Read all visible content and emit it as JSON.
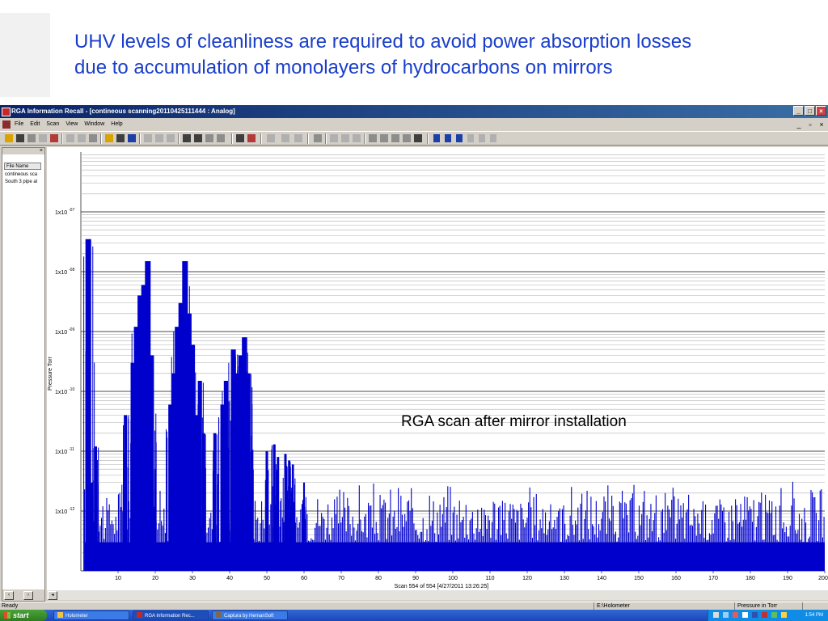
{
  "slide": {
    "title_line1": "UHV levels of cleanliness are required to avoid power absorption losses",
    "title_line2": "due to accumulation of monolayers of hydrocarbons on mirrors",
    "annotation": "RGA scan after mirror installation"
  },
  "window": {
    "title": "RGA Information Recall - [contineous scanning20110425111444 : Analog]",
    "menu": [
      "File",
      "Edit",
      "Scan",
      "View",
      "Window",
      "Help"
    ]
  },
  "sidebar": {
    "close_glyph": "×",
    "column_header": "File Name",
    "files": [
      "contineous sca",
      "South 3 pipe al"
    ]
  },
  "chart_data": {
    "type": "bar",
    "xlabel": "",
    "ylabel": "Pressure Torr",
    "yscale": "log",
    "ylim": [
      1e-13,
      1e-06
    ],
    "xlim": [
      0,
      200
    ],
    "x_ticks": [
      10,
      20,
      30,
      40,
      50,
      60,
      70,
      80,
      90,
      100,
      110,
      120,
      130,
      140,
      150,
      160,
      170,
      180,
      190,
      200
    ],
    "y_ticks": [
      {
        "base": "1x10",
        "exp": "-07",
        "value": 1e-07
      },
      {
        "base": "1x10",
        "exp": "-08",
        "value": 1e-08
      },
      {
        "base": "1x10",
        "exp": "-09",
        "value": 1e-09
      },
      {
        "base": "1x10",
        "exp": "-10",
        "value": 1e-10
      },
      {
        "base": "1x10",
        "exp": "-11",
        "value": 1e-11
      },
      {
        "base": "1x10",
        "exp": "-12",
        "value": 1e-12
      }
    ],
    "scan_label": "Scan 554 of 554 [4/27/2011 13:26:25]",
    "color": "#0000cc",
    "peaks": [
      {
        "x": 2,
        "y": 3.5e-08
      },
      {
        "x": 3,
        "y": 3e-12
      },
      {
        "x": 4,
        "y": 1.2e-11
      },
      {
        "x": 12,
        "y": 4e-11
      },
      {
        "x": 14,
        "y": 3e-10
      },
      {
        "x": 15,
        "y": 1.2e-09
      },
      {
        "x": 16,
        "y": 4e-09
      },
      {
        "x": 17,
        "y": 6e-09
      },
      {
        "x": 18,
        "y": 1.5e-08
      },
      {
        "x": 19,
        "y": 4e-10
      },
      {
        "x": 20,
        "y": 5e-12
      },
      {
        "x": 24,
        "y": 6e-11
      },
      {
        "x": 25,
        "y": 2e-10
      },
      {
        "x": 26,
        "y": 1.2e-09
      },
      {
        "x": 27,
        "y": 3e-09
      },
      {
        "x": 28,
        "y": 1.5e-08
      },
      {
        "x": 29,
        "y": 2e-09
      },
      {
        "x": 30,
        "y": 6e-10
      },
      {
        "x": 31,
        "y": 4e-11
      },
      {
        "x": 32,
        "y": 1.5e-10
      },
      {
        "x": 33,
        "y": 2e-11
      },
      {
        "x": 36,
        "y": 2e-11
      },
      {
        "x": 38,
        "y": 6e-11
      },
      {
        "x": 39,
        "y": 1.5e-10
      },
      {
        "x": 41,
        "y": 5e-10
      },
      {
        "x": 42,
        "y": 2e-10
      },
      {
        "x": 43,
        "y": 4e-10
      },
      {
        "x": 44,
        "y": 8e-10
      },
      {
        "x": 45,
        "y": 2e-10
      },
      {
        "x": 46,
        "y": 1e-11
      },
      {
        "x": 50,
        "y": 1e-11
      },
      {
        "x": 52,
        "y": 1.3e-11
      },
      {
        "x": 53,
        "y": 8e-12
      },
      {
        "x": 55,
        "y": 9e-12
      },
      {
        "x": 56,
        "y": 7e-12
      },
      {
        "x": 57,
        "y": 6e-12
      },
      {
        "x": 60,
        "y": 3e-12
      }
    ],
    "noise_floor": 3e-13,
    "noise_level": 2e-12
  },
  "statusbar": {
    "ready": "Ready",
    "path": "E:\\Holometer",
    "units": "Pressure in Torr"
  },
  "taskbar": {
    "start": "start",
    "tasks": [
      "Holometer",
      "RGA Information Rec...",
      "Captura by HernanSoft"
    ],
    "clock": "1:54 PM"
  }
}
